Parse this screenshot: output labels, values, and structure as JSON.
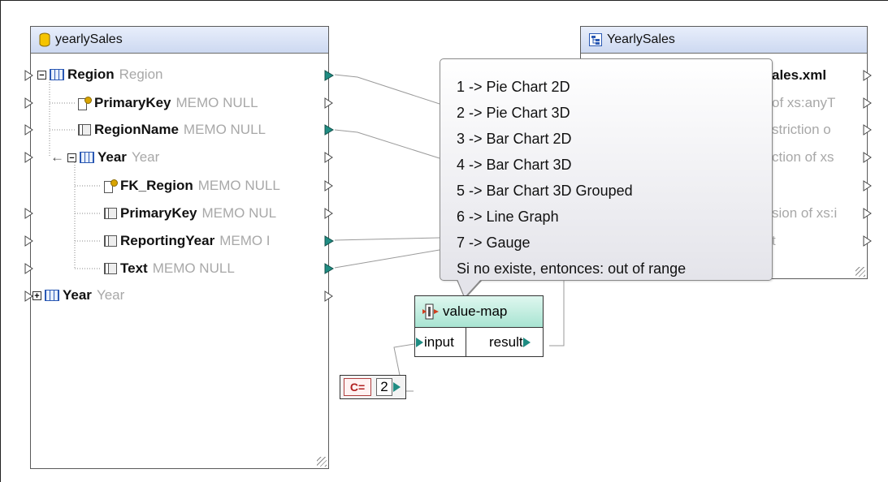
{
  "source": {
    "title": "yearlySales",
    "rows": [
      {
        "name": "Region",
        "type": "Region"
      },
      {
        "name": "PrimaryKey",
        "type": "MEMO NULL"
      },
      {
        "name": "RegionName",
        "type": "MEMO NULL"
      },
      {
        "name": "Year",
        "type": "Year"
      },
      {
        "name": "FK_Region",
        "type": "MEMO NULL"
      },
      {
        "name": "PrimaryKey",
        "type": "MEMO NUL"
      },
      {
        "name": "ReportingYear",
        "type": "MEMO I"
      },
      {
        "name": "Text",
        "type": "MEMO NULL"
      },
      {
        "name": "Year",
        "type": "Year"
      }
    ]
  },
  "target": {
    "title": "YearlySales",
    "rows": [
      {
        "text": "ales.xml"
      },
      {
        "text": "of xs:anyT"
      },
      {
        "text": "striction o"
      },
      {
        "text": "ction of xs"
      },
      {
        "text": "sion of xs:i"
      },
      {
        "text": "t"
      }
    ]
  },
  "tooltip": {
    "lines": [
      "1 -> Pie Chart 2D",
      "2 -> Pie Chart 3D",
      "3 -> Bar Chart 2D",
      "4 -> Bar Chart 3D",
      "5 -> Bar Chart 3D Grouped",
      "6 -> Line Graph",
      "7 -> Gauge",
      "Si no existe, entonces: out of range"
    ]
  },
  "value_map": {
    "title": "value-map",
    "input_label": "input",
    "result_label": "result"
  },
  "constant": {
    "icon_text": "C=",
    "value": "2"
  },
  "colors": {
    "port_connected": "#1f8c82",
    "header_blue": "#cdd9f1",
    "header_green": "#a8e4d2",
    "type_gray": "#a8a8a8"
  }
}
